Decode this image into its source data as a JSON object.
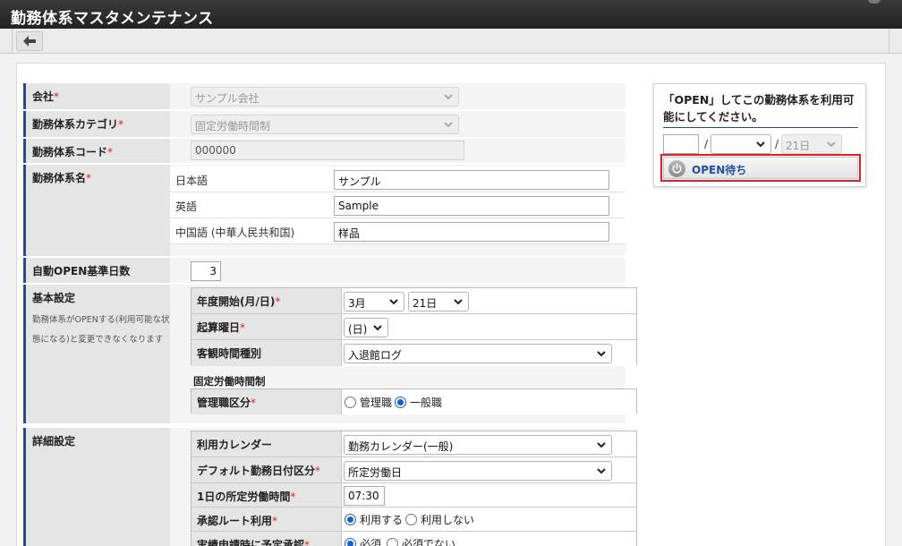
{
  "header": {
    "title": "勤務体系マスタメンテナンス"
  },
  "form": {
    "company": {
      "label": "会社",
      "required": "*",
      "value": "サンプル会社"
    },
    "category": {
      "label": "勤務体系カテゴリ",
      "required": "*",
      "value": "固定労働時間制"
    },
    "code": {
      "label": "勤務体系コード",
      "required": "*",
      "value": "000000"
    },
    "name": {
      "label": "勤務体系名",
      "required": "*",
      "rows": [
        {
          "lang": "日本語",
          "value": "サンプル"
        },
        {
          "lang": "英語",
          "value": "Sample"
        },
        {
          "lang": "中国語 (中華人民共和国)",
          "value": "样品"
        }
      ]
    },
    "auto_open": {
      "label": "自動OPEN基準日数",
      "value": "3"
    },
    "basic": {
      "label": "基本設定",
      "note": "勤務体系がOPENする(利用可能な状態になる)と変更できなくなります",
      "fiscal_start": {
        "label": "年度開始(月/日)",
        "required": "*",
        "month": "3月",
        "day": "21日"
      },
      "start_weekday": {
        "label": "起算曜日",
        "required": "*",
        "value": "(日)"
      },
      "objective_time": {
        "label": "客観時間種別",
        "value": "入退館ログ"
      },
      "group_label": "固定労働時間制",
      "manager_class": {
        "label": "管理職区分",
        "required": "*",
        "options": [
          "管理職",
          "一般職"
        ],
        "selected": "一般職"
      }
    },
    "detail": {
      "label": "詳細設定",
      "calendar": {
        "label": "利用カレンダー",
        "value": "勤務カレンダー(一般)"
      },
      "default_day": {
        "label": "デフォルト勤務日付区分",
        "required": "*",
        "value": "所定労働日"
      },
      "daily_hours": {
        "label": "1日の所定労働時間",
        "required": "*",
        "value": "07:30"
      },
      "approval_route": {
        "label": "承認ルート利用",
        "required": "*",
        "options": [
          "利用する",
          "利用しない"
        ],
        "selected": "利用する"
      },
      "pre_approval": {
        "label": "実績申請時に予定承認",
        "required": "*",
        "options": [
          "必須",
          "必須でない"
        ],
        "selected": "必須"
      }
    }
  },
  "side": {
    "message": "「OPEN」してこの勤務体系を利用可能にしてください。",
    "date_sep": "/",
    "year": "",
    "month": "",
    "day": "21日",
    "open_button": "OPEN待ち"
  },
  "icons": {
    "back": "arrow-left-icon",
    "chevron": "chevron-down-icon",
    "power": "power-icon"
  },
  "colors": {
    "accent": "#2a4a8a",
    "required": "#dd2222",
    "highlight": "#e02020",
    "link": "#1f4fa8"
  }
}
